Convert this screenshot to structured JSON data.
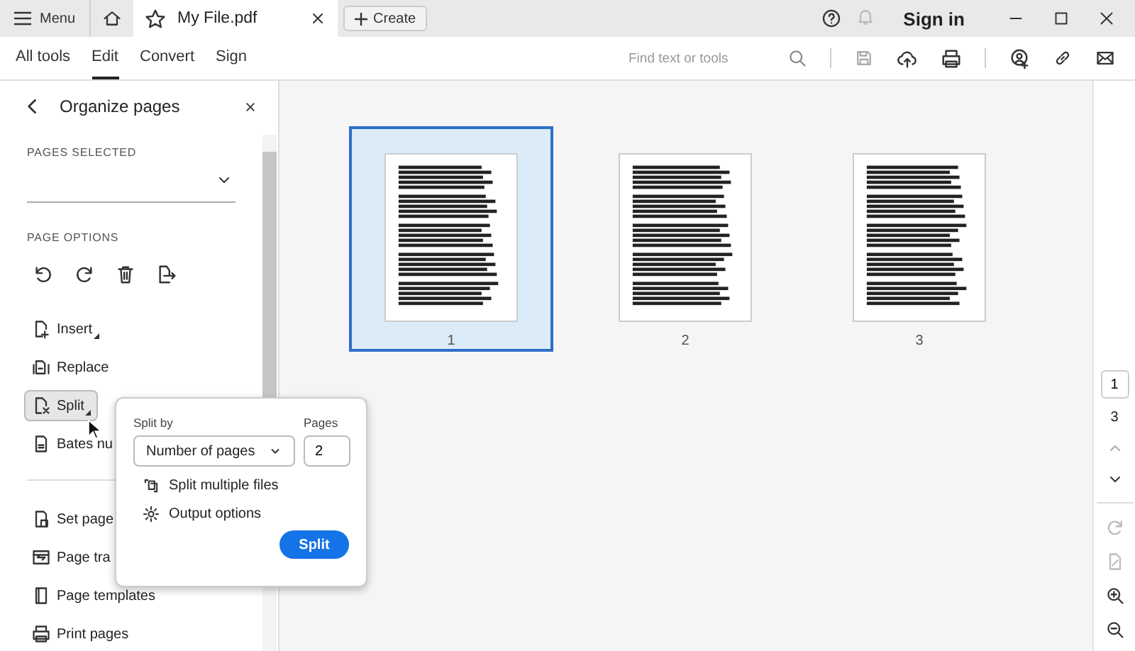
{
  "title_bar": {
    "menu": "Menu",
    "tab": {
      "title": "My File.pdf"
    },
    "create": "Create",
    "sign_in": "Sign in"
  },
  "toolbar": {
    "tabs": [
      {
        "label": "All tools",
        "selected": false
      },
      {
        "label": "Edit",
        "selected": true
      },
      {
        "label": "Convert",
        "selected": false
      },
      {
        "label": "Sign",
        "selected": false
      }
    ],
    "search": {
      "placeholder": "Find text or tools"
    }
  },
  "panel": {
    "title": "Organize pages",
    "pages_selected_label": "PAGES SELECTED",
    "page_options_label": "PAGE OPTIONS",
    "tools": [
      {
        "kind": "insert",
        "label": "Insert",
        "has_menu": true,
        "selected": false
      },
      {
        "kind": "replace",
        "label": "Replace",
        "has_menu": false,
        "selected": false
      },
      {
        "kind": "split",
        "label": "Split",
        "has_menu": true,
        "selected": true
      },
      {
        "kind": "bates",
        "label": "Bates nu",
        "has_menu": false,
        "selected": false
      }
    ],
    "more_tools": [
      {
        "kind": "setsize",
        "label": "Set page"
      },
      {
        "kind": "transition",
        "label": "Page tra"
      },
      {
        "kind": "template",
        "label": "Page templates"
      },
      {
        "kind": "print",
        "label": "Print pages"
      }
    ]
  },
  "split_popup": {
    "split_by_label": "Split by",
    "split_by": "Number of pages",
    "pages_label": "Pages",
    "pages": "2",
    "options": [
      {
        "kind": "files",
        "label": "Split multiple files"
      },
      {
        "kind": "output",
        "label": "Output options"
      }
    ],
    "button": "Split"
  },
  "pages": [
    {
      "number": "1",
      "selected": true
    },
    {
      "number": "2",
      "selected": false
    },
    {
      "number": "3",
      "selected": false
    }
  ],
  "navigator": {
    "current_page": "1",
    "total_pages": "3"
  }
}
